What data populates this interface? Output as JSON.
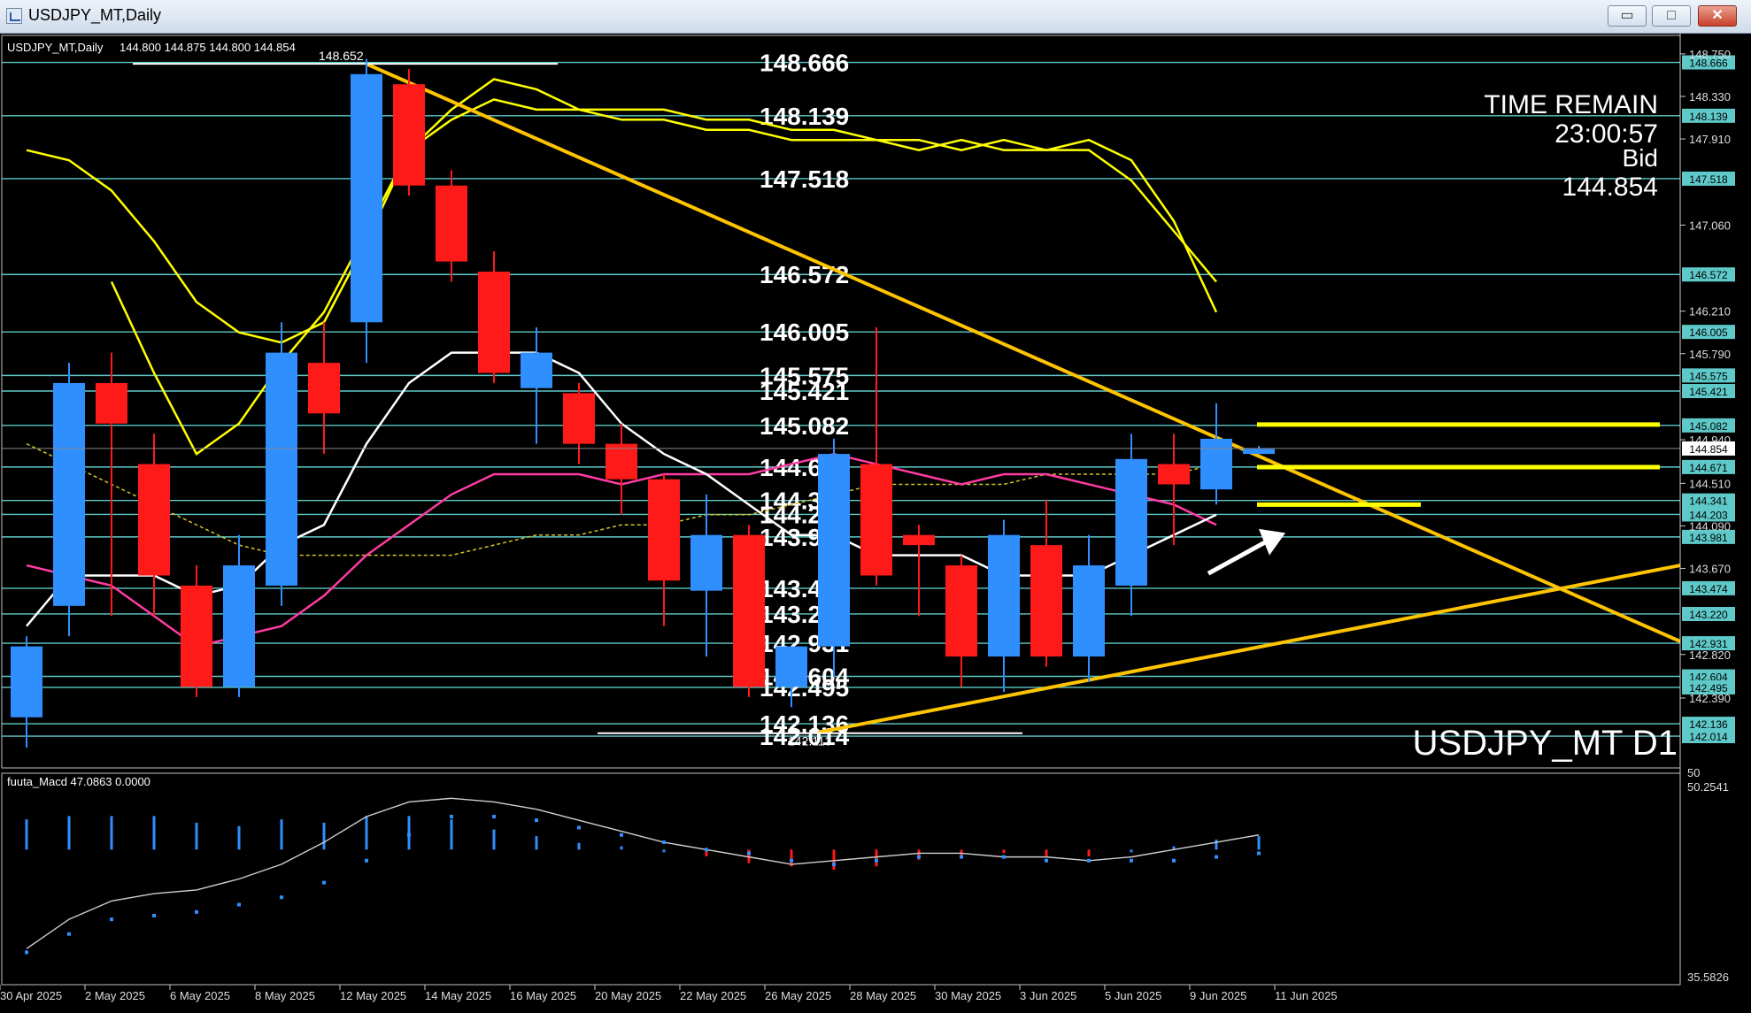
{
  "window": {
    "title": "USDJPY_MT,Daily",
    "buttons": {
      "minimize": "▭",
      "maximize": "□",
      "close": "✕"
    }
  },
  "chart_data": {
    "type": "candlestick",
    "symbol_label": "USDJPY_MT,Daily",
    "ohlc_label": "144.800 144.875 144.800 144.854",
    "watermark": "USDJPY_MT D1",
    "time_remain": {
      "label": "TIME REMAIN",
      "value": "23:00:57",
      "bid_label": "Bid",
      "bid_value": "144.854"
    },
    "main_ylim": [
      141.7,
      148.95
    ],
    "x_labels": [
      {
        "i": 0,
        "text": "30 Apr 2025"
      },
      {
        "i": 2,
        "text": "2 May 2025"
      },
      {
        "i": 4,
        "text": "6 May 2025"
      },
      {
        "i": 6,
        "text": "8 May 2025"
      },
      {
        "i": 8,
        "text": "12 May 2025"
      },
      {
        "i": 10,
        "text": "14 May 2025"
      },
      {
        "i": 12,
        "text": "16 May 2025"
      },
      {
        "i": 14,
        "text": "20 May 2025"
      },
      {
        "i": 16,
        "text": "22 May 2025"
      },
      {
        "i": 18,
        "text": "26 May 2025"
      },
      {
        "i": 20,
        "text": "28 May 2025"
      },
      {
        "i": 22,
        "text": "30 May 2025"
      },
      {
        "i": 24,
        "text": "3 Jun 2025"
      },
      {
        "i": 26,
        "text": "5 Jun 2025"
      },
      {
        "i": 28,
        "text": "9 Jun 2025"
      },
      {
        "i": 30,
        "text": "11 Jun 2025"
      }
    ],
    "y_axis_ticks": [
      "148.750",
      "148.330",
      "147.910",
      "147.060",
      "146.210",
      "145.790",
      "144.940",
      "144.510",
      "144.090",
      "143.670",
      "142.820",
      "142.390"
    ],
    "levels": [
      "148.666",
      "148.139",
      "147.518",
      "146.572",
      "146.005",
      "145.575",
      "145.421",
      "145.082",
      "144.671",
      "144.341",
      "144.203",
      "143.981",
      "143.474",
      "143.220",
      "142.931",
      "142.604",
      "142.495",
      "142.136",
      "142.014"
    ],
    "bid_level": "144.854",
    "high_mark": {
      "label": "148.652",
      "value": 148.652
    },
    "low_mark": {
      "label": "142.113",
      "value": 142.113
    },
    "candles": [
      {
        "o": 142.2,
        "h": 143.0,
        "l": 141.9,
        "c": 142.9
      },
      {
        "o": 143.3,
        "h": 145.7,
        "l": 143.0,
        "c": 145.5
      },
      {
        "o": 145.5,
        "h": 145.8,
        "l": 143.2,
        "c": 145.1
      },
      {
        "o": 144.7,
        "h": 145.0,
        "l": 143.2,
        "c": 143.6
      },
      {
        "o": 143.5,
        "h": 143.7,
        "l": 142.4,
        "c": 142.5
      },
      {
        "o": 142.5,
        "h": 144.0,
        "l": 142.4,
        "c": 143.7
      },
      {
        "o": 143.5,
        "h": 146.1,
        "l": 143.3,
        "c": 145.8
      },
      {
        "o": 145.7,
        "h": 146.1,
        "l": 144.8,
        "c": 145.2
      },
      {
        "o": 146.1,
        "h": 148.7,
        "l": 145.7,
        "c": 148.55
      },
      {
        "o": 148.45,
        "h": 148.6,
        "l": 147.35,
        "c": 147.45
      },
      {
        "o": 147.45,
        "h": 147.6,
        "l": 146.5,
        "c": 146.7
      },
      {
        "o": 146.6,
        "h": 146.8,
        "l": 145.5,
        "c": 145.6
      },
      {
        "o": 145.45,
        "h": 146.05,
        "l": 144.9,
        "c": 145.8
      },
      {
        "o": 145.4,
        "h": 145.5,
        "l": 144.7,
        "c": 144.9
      },
      {
        "o": 144.9,
        "h": 145.1,
        "l": 144.2,
        "c": 144.55
      },
      {
        "o": 144.55,
        "h": 144.6,
        "l": 143.1,
        "c": 143.55
      },
      {
        "o": 143.45,
        "h": 144.4,
        "l": 142.8,
        "c": 144.0
      },
      {
        "o": 144.0,
        "h": 144.1,
        "l": 142.4,
        "c": 142.5
      },
      {
        "o": 142.5,
        "h": 142.9,
        "l": 142.3,
        "c": 142.9
      },
      {
        "o": 142.9,
        "h": 144.95,
        "l": 142.6,
        "c": 144.8
      },
      {
        "o": 144.7,
        "h": 146.05,
        "l": 143.5,
        "c": 143.6
      },
      {
        "o": 144.0,
        "h": 144.1,
        "l": 143.2,
        "c": 143.9
      },
      {
        "o": 143.7,
        "h": 143.8,
        "l": 142.5,
        "c": 142.8
      },
      {
        "o": 142.8,
        "h": 144.15,
        "l": 142.45,
        "c": 144.0
      },
      {
        "o": 143.9,
        "h": 144.35,
        "l": 142.7,
        "c": 142.8
      },
      {
        "o": 142.8,
        "h": 144.0,
        "l": 142.55,
        "c": 143.7
      },
      {
        "o": 143.5,
        "h": 145.0,
        "l": 143.2,
        "c": 144.75
      },
      {
        "o": 144.7,
        "h": 145.0,
        "l": 143.9,
        "c": 144.5
      },
      {
        "o": 144.45,
        "h": 145.3,
        "l": 144.3,
        "c": 144.95
      },
      {
        "o": 144.8,
        "h": 144.88,
        "l": 144.8,
        "c": 144.85
      }
    ],
    "ma_fast": [
      143.1,
      143.6,
      143.6,
      143.6,
      143.4,
      143.5,
      143.9,
      144.1,
      144.9,
      145.5,
      145.8,
      145.8,
      145.8,
      145.6,
      145.1,
      144.8,
      144.6,
      144.3,
      144.0,
      144.0,
      143.8,
      143.8,
      143.8,
      143.6,
      143.6,
      143.6,
      143.8,
      144.0,
      144.2,
      null
    ],
    "ma_mid": [
      143.7,
      143.6,
      143.5,
      143.2,
      142.9,
      143.0,
      143.1,
      143.4,
      143.8,
      144.1,
      144.4,
      144.6,
      144.6,
      144.6,
      144.5,
      144.6,
      144.6,
      144.6,
      144.7,
      144.8,
      144.7,
      144.6,
      144.5,
      144.6,
      144.6,
      144.5,
      144.4,
      144.3,
      144.1,
      null
    ],
    "ma_slow": [
      144.9,
      144.7,
      144.5,
      144.3,
      144.1,
      143.9,
      143.8,
      143.8,
      143.8,
      143.8,
      143.8,
      143.9,
      144.0,
      144.0,
      144.1,
      144.1,
      144.2,
      144.2,
      144.3,
      144.4,
      144.5,
      144.5,
      144.5,
      144.5,
      144.6,
      144.6,
      144.6,
      144.6,
      144.7,
      null
    ],
    "env_upper": [
      147.8,
      147.7,
      147.4,
      146.9,
      146.3,
      146.0,
      145.9,
      146.1,
      146.9,
      147.8,
      148.1,
      148.3,
      148.2,
      148.2,
      148.2,
      148.2,
      148.1,
      148.1,
      148.0,
      148.0,
      147.9,
      147.9,
      147.8,
      147.9,
      147.8,
      147.9,
      147.7,
      147.1,
      146.2,
      null
    ],
    "env_lower": [
      null,
      null,
      null,
      null,
      null,
      null,
      null,
      null,
      null,
      null,
      null,
      null,
      null,
      null,
      null,
      null,
      null,
      null,
      null,
      null,
      null,
      null,
      null,
      null,
      null,
      null,
      null,
      null,
      null,
      null
    ],
    "bb_upper": [
      null,
      null,
      146.5,
      145.6,
      144.8,
      145.1,
      145.7,
      146.2,
      147.0,
      147.8,
      148.2,
      148.5,
      148.4,
      148.2,
      148.1,
      148.1,
      148.0,
      148.0,
      147.9,
      147.9,
      147.9,
      147.8,
      147.9,
      147.8,
      147.8,
      147.8,
      147.5,
      147.0,
      146.5,
      null
    ],
    "macd": {
      "label": "fuuta_Macd 47.0863 0.0000",
      "ylim": [
        35.5826,
        50.2541
      ],
      "tick_labels": [
        "50",
        "50.2541",
        "35.5826"
      ],
      "histogram": [
        0.9,
        1.0,
        1.0,
        1.0,
        0.8,
        0.7,
        0.9,
        0.8,
        1.0,
        1.0,
        0.9,
        0.6,
        0.4,
        0.2,
        0.1,
        0.0,
        -0.2,
        -0.4,
        -0.5,
        -0.6,
        -0.5,
        -0.3,
        -0.2,
        -0.1,
        -0.2,
        -0.2,
        0.0,
        0.1,
        0.3,
        0.4
      ],
      "signal": [
        -2.8,
        -2.3,
        -1.9,
        -1.8,
        -1.7,
        -1.5,
        -1.3,
        -0.9,
        -0.3,
        0.4,
        0.9,
        0.9,
        0.8,
        0.6,
        0.4,
        0.2,
        0.0,
        -0.1,
        -0.3,
        -0.4,
        -0.3,
        -0.2,
        -0.2,
        -0.2,
        -0.3,
        -0.3,
        -0.3,
        -0.3,
        -0.2,
        -0.1
      ],
      "line": [
        -2.7,
        -1.9,
        -1.4,
        -1.2,
        -1.1,
        -0.8,
        -0.4,
        0.2,
        0.9,
        1.3,
        1.4,
        1.3,
        1.1,
        0.8,
        0.5,
        0.2,
        0.0,
        -0.2,
        -0.4,
        -0.3,
        -0.2,
        -0.1,
        -0.1,
        -0.2,
        -0.2,
        -0.3,
        -0.2,
        0.0,
        0.2,
        0.4
      ]
    },
    "colors": {
      "bull": "#2f8fff",
      "bear": "#ff1a1a",
      "grid": "#5fc9c9",
      "trend": "#ffc400",
      "env": "#ffff00",
      "ma_fast": "#ffffff",
      "ma_mid": "#ff3ba4",
      "ma_slow": "#d6c420"
    }
  }
}
